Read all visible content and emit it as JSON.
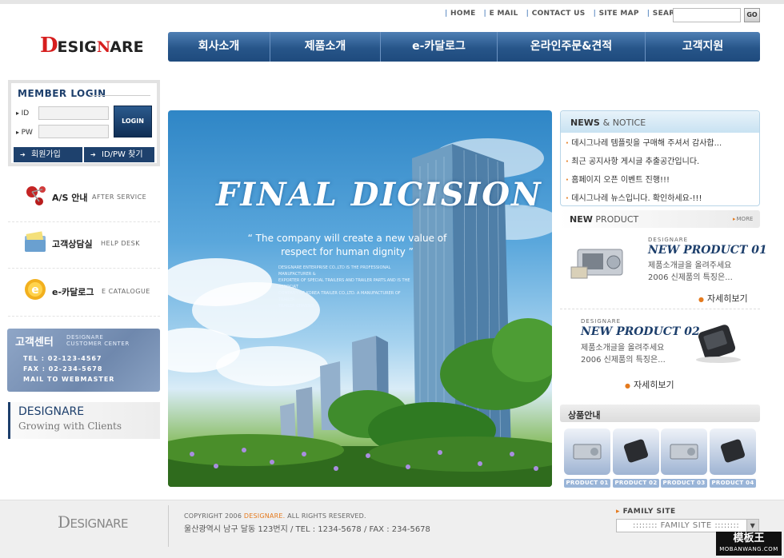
{
  "utility_nav": [
    "HOME",
    "E MAIL",
    "CONTACT US",
    "SITE MAP",
    "SEARCH"
  ],
  "search": {
    "value": "",
    "go_label": "GO"
  },
  "logo": {
    "d": "D",
    "esig": "ESIG",
    "n": "N",
    "are": "ARE"
  },
  "main_nav": [
    "회사소개",
    "제품소개",
    "e-카달로그",
    "온라인주문&견적",
    "고객지원"
  ],
  "login": {
    "title": "MEMBER LOGIN",
    "id_label": "ID",
    "pw_label": "PW",
    "button_label": "LOGIN",
    "join_label": "회원가입",
    "find_label": "ID/PW 찾기"
  },
  "services": [
    {
      "ko": "A/S 안내",
      "en": "AFTER SERVICE",
      "icon": "molecule-icon"
    },
    {
      "ko": "고객상담실",
      "en": "HELP DESK",
      "icon": "folder-icon"
    },
    {
      "ko": "e-카달로그",
      "en": "E CATALOGUE",
      "icon": "e-catalog-icon"
    }
  ],
  "customer_center": {
    "title": "고객센터",
    "subtitle_1": "DESIGNARE",
    "subtitle_2": "CUSTOMER CENTER",
    "tel": "TEL : 02-123-4567",
    "fax": "FAX : 02-234-5678",
    "mail": "MAIL TO WEBMASTER"
  },
  "slogan": {
    "brand": "DESIGNARE",
    "tagline": "Growing with Clients"
  },
  "hero": {
    "title": "FINAL DICISION",
    "quote_1": "“ The company will create a new value of",
    "quote_2": "respect for human dignity ”",
    "small_1": "DESIGNARE ENTERPRISE CO.,LTD IS THE PROFESSIONAL MANUFACTURER &",
    "small_2": "EXPORTER OF SPECIAL TRAILERS AND TRAILER PARTS.AND IS THE ASSOCIAT",
    "small_3": "COMPANY OF KOREA TRAILER CO.,LTD. A MANUFACTURER OF TRAILER",
    "small_4": "TRAILER CHASSIS."
  },
  "news": {
    "title": "NEWS",
    "title_amp": "& NOTICE",
    "items": [
      "데시그나레 템플릿을 구매해 주셔서 감사합...",
      "최근 공지사항 게시글 추출공간입니다.",
      "홈페이지 오픈 이벤트 진행!!!",
      "데시그나레 뉴스입니다. 확인하세요-!!!"
    ]
  },
  "new_product": {
    "title_bold": "NEW",
    "title_rest": "PRODUCT",
    "more_label": "MORE",
    "products": [
      {
        "tag": "DESIGNARE",
        "name": "NEW PRODUCT 01",
        "desc_1": "제품소개글을 올려주세요",
        "desc_2": "2006 신제품의 특징은...",
        "detail": "자세히보기"
      },
      {
        "tag": "DESIGNARE",
        "name": "NEW PRODUCT 02",
        "desc_1": "제품소개글을 올려주세요",
        "desc_2": "2006 신제품의 특징은...",
        "detail": "자세히보기"
      }
    ]
  },
  "product_info": {
    "title": "상품안내",
    "items": [
      "PRODUCT 01",
      "PRODUCT 02",
      "PRODUCT 03",
      "PRODUCT 04"
    ]
  },
  "footer": {
    "copyright_pre": "COPYRIGHT 2006",
    "copyright_brand": "DESIGNARE.",
    "copyright_post": "ALL RIGHTS RESERVED.",
    "address": "울산광역시 남구 달동 123번지  /  TEL : 1234-5678  /  FAX : 234-5678",
    "family_label": "FAMILY SITE",
    "family_value": ":::::::: FAMILY SITE ::::::::"
  },
  "watermark": {
    "line1": "模板王",
    "line2": "MOBANWANG.COM"
  },
  "colors": {
    "navy": "#1d3f6c",
    "nav_blue": "#275589",
    "accent_orange": "#e47a1e",
    "logo_red": "#d61e1e"
  }
}
